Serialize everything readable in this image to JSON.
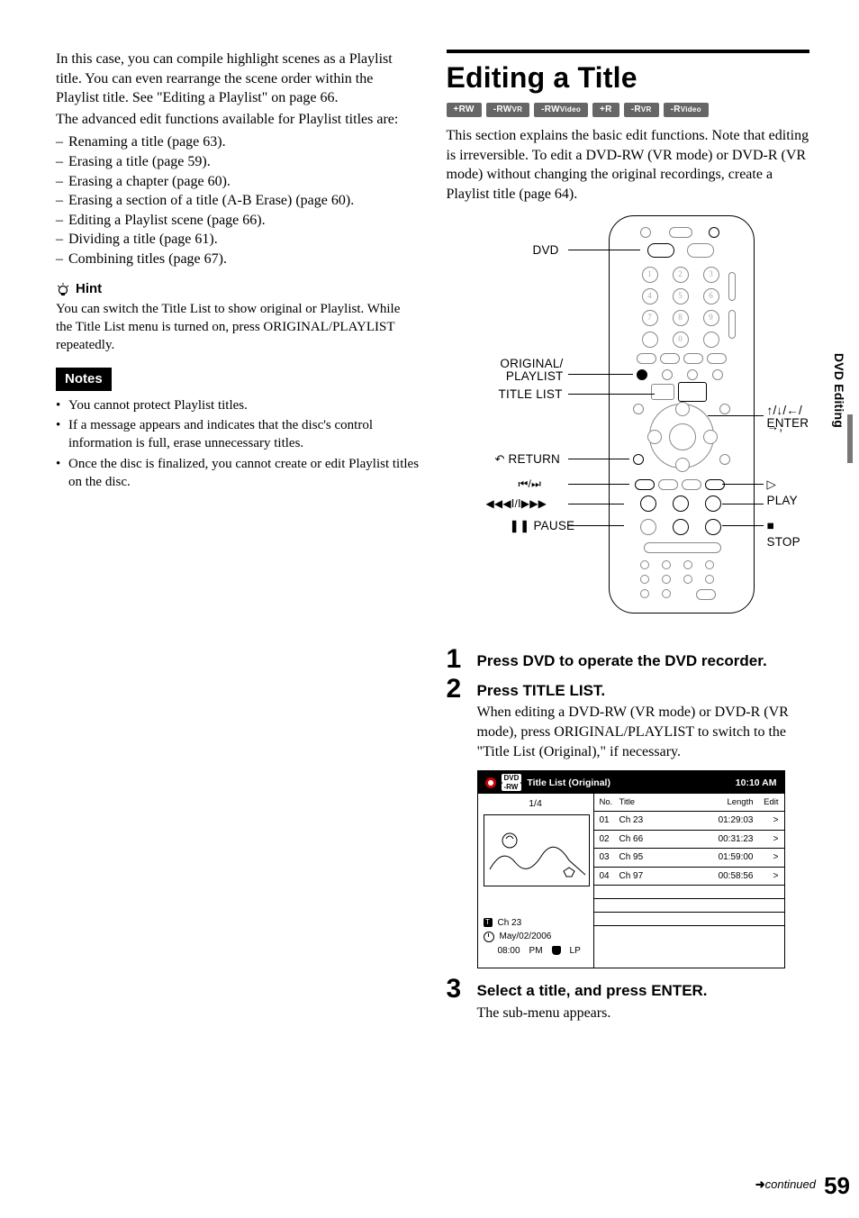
{
  "left": {
    "intro": "In this case, you can compile highlight scenes as a Playlist title. You can even rearrange the scene order within the Playlist title. See \"Editing a Playlist\" on page 66.",
    "adv_lead": "The advanced edit functions available for Playlist titles are:",
    "adv_items": [
      "Renaming a title (page 63).",
      "Erasing a title (page 59).",
      "Erasing a chapter (page 60).",
      "Erasing a section of a title (A-B Erase) (page 60).",
      "Editing a Playlist scene (page 66).",
      "Dividing a title (page 61).",
      "Combining titles (page 67)."
    ],
    "hint_label": "Hint",
    "hint_body": "You can switch the Title List to show original or Playlist. While the Title List menu is turned on, press ORIGINAL/PLAYLIST repeatedly.",
    "notes_label": "Notes",
    "notes_items": [
      "You cannot protect Playlist titles.",
      "If a message appears and indicates that the disc's control information is full, erase unnecessary titles.",
      "Once the disc is finalized, you cannot create or edit Playlist titles on the disc."
    ]
  },
  "right": {
    "title": "Editing a Title",
    "chips": [
      "+RW",
      "-RWVR",
      "-RWVideo",
      "+R",
      "-RVR",
      "-RVideo"
    ],
    "intro": "This section explains the basic edit functions. Note that editing is irreversible. To edit a DVD-RW (VR mode) or DVD-R (VR mode) without changing the original recordings, create a Playlist title (page 64).",
    "remote_labels": {
      "dvd": "DVD",
      "orig_playlist_l1": "ORIGINAL/",
      "orig_playlist_l2": "PLAYLIST",
      "title_list": "TITLE LIST",
      "return": "RETURN",
      "prev_next": "⏮/⏭",
      "scan": "◀◀◀Ⅰ/Ⅰ▶▶▶",
      "pause": "❚❚ PAUSE",
      "arrows_enter_l1": "↑/↓/←/→,",
      "arrows_enter_l2": "ENTER",
      "play": "▷ PLAY",
      "stop": "■ STOP"
    },
    "steps": [
      {
        "n": "1",
        "title": "Press DVD to operate the DVD recorder.",
        "text": ""
      },
      {
        "n": "2",
        "title": "Press TITLE LIST.",
        "text": "When editing a DVD-RW (VR mode) or DVD-R (VR mode), press ORIGINAL/PLAYLIST to switch to the \"Title List (Original),\" if necessary."
      },
      {
        "n": "3",
        "title": "Select a title, and press ENTER.",
        "text": "The sub-menu appears."
      }
    ],
    "osd": {
      "badge_top": "DVD",
      "badge_bot": "-RW",
      "head_title": "Title List (Original)",
      "clock": "10:10 AM",
      "page": "1/4",
      "cols": {
        "no": "No.",
        "title": "Title",
        "length": "Length",
        "edit": "Edit"
      },
      "rows": [
        {
          "no": "01",
          "title": "Ch 23",
          "length": "01:29:03",
          "edit": ">"
        },
        {
          "no": "02",
          "title": "Ch 66",
          "length": "00:31:23",
          "edit": ">"
        },
        {
          "no": "03",
          "title": "Ch 95",
          "length": "01:59:00",
          "edit": ">"
        },
        {
          "no": "04",
          "title": "Ch 97",
          "length": "00:58:56",
          "edit": ">"
        }
      ],
      "meta": {
        "t_line": "Ch 23",
        "date": "May/02/2006",
        "time": "08:00",
        "ampm": "PM",
        "mode": "LP"
      }
    }
  },
  "side_tab": "DVD Editing",
  "continued": "continued",
  "page_number": "59"
}
